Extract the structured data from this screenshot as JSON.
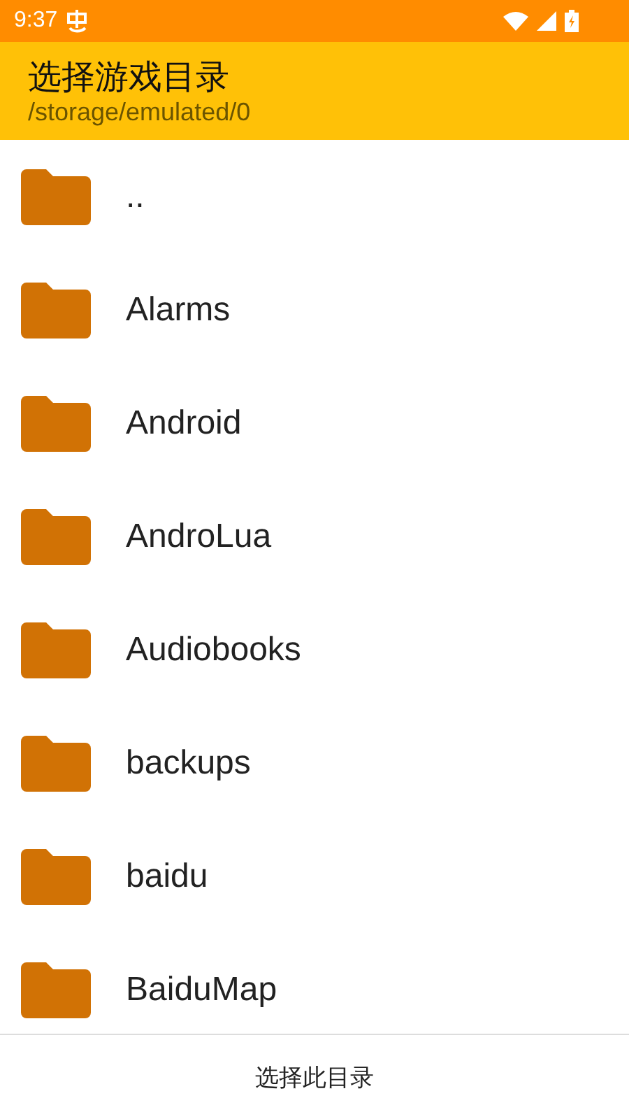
{
  "status_bar": {
    "time": "9:37"
  },
  "header": {
    "title": "选择游戏目录",
    "path": "/storage/emulated/0"
  },
  "folders": [
    {
      "name": ".."
    },
    {
      "name": "Alarms"
    },
    {
      "name": "Android"
    },
    {
      "name": "AndroLua"
    },
    {
      "name": "Audiobooks"
    },
    {
      "name": "backups"
    },
    {
      "name": "baidu"
    },
    {
      "name": "BaiduMap"
    }
  ],
  "footer": {
    "button": "选择此目录"
  }
}
